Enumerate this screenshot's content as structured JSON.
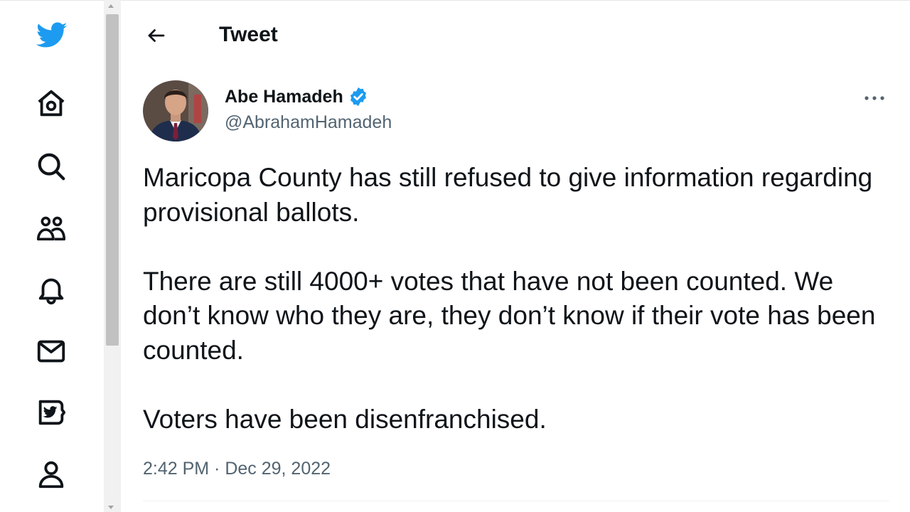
{
  "header": {
    "title": "Tweet"
  },
  "nav": {
    "items": [
      {
        "icon": "twitter-bird-icon"
      },
      {
        "icon": "home-icon"
      },
      {
        "icon": "search-icon"
      },
      {
        "icon": "communities-icon"
      },
      {
        "icon": "notifications-bell-icon"
      },
      {
        "icon": "messages-envelope-icon"
      },
      {
        "icon": "twitter-blue-icon"
      },
      {
        "icon": "profile-icon"
      }
    ]
  },
  "tweet": {
    "author_name": "Abe Hamadeh",
    "author_handle": "@AbrahamHamadeh",
    "verified": true,
    "paragraphs": [
      "Maricopa County has still refused to give information regarding provisional ballots.",
      "There are still 4000+ votes that have not been counted. We don’t know who they are, they don’t know if their vote has been counted.",
      "Voters have been disenfranchised."
    ],
    "timestamp": "2:42 PM · Dec 29, 2022"
  },
  "colors": {
    "brand_blue": "#1d9bf0",
    "text_primary": "#0f1419",
    "text_secondary": "#536471"
  }
}
